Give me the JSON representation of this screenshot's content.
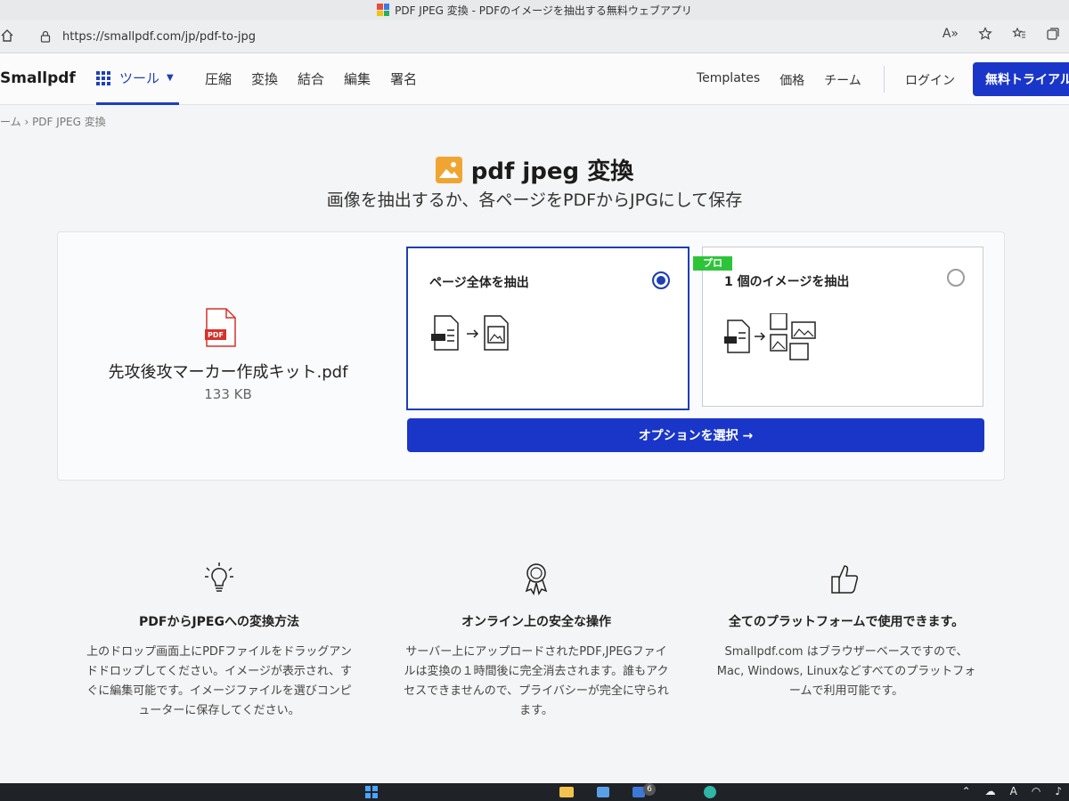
{
  "browser": {
    "window_title": "PDF JPEG 変換 - PDFのイメージを抽出する無料ウェブアプリ",
    "url": "https://smallpdf.com/jp/pdf-to-jpg",
    "reader_icon": "A»"
  },
  "nav": {
    "logo": "Smallpdf",
    "tools_label": "ツール",
    "links": [
      "圧縮",
      "変換",
      "結合",
      "編集",
      "署名"
    ],
    "templates": "Templates",
    "pricing": "価格",
    "team": "チーム",
    "login": "ログイン",
    "trial": "無料トライアル"
  },
  "breadcrumb": "ーム › PDF JPEG 変換",
  "page": {
    "title": "pdf jpeg 変換",
    "subtitle": "画像を抽出するか、各ページをPDFからJPGにして保存"
  },
  "file": {
    "name": "先攻後攻マーカー作成キット.pdf",
    "size": "133 KB",
    "badge": "PDF"
  },
  "options": [
    {
      "label": "ページ全体を抽出",
      "selected": true
    },
    {
      "label": "1 個のイメージを抽出",
      "selected": false,
      "badge": "プロ"
    }
  ],
  "select_button": "オプションを選択 →",
  "features": [
    {
      "title": "PDFからJPEGへの変換方法",
      "text": "上のドロップ画面上にPDFファイルをドラッグアンドドロップしてください。イメージが表示され、すぐに編集可能です。イメージファイルを選びコンピューターに保存してください。"
    },
    {
      "title": "オンライン上の安全な操作",
      "text": "サーバー上にアップロードされたPDF,JPEGファイルは変換の１時間後に完全消去されます。誰もアクセスできませんので、プライバシーが完全に守られます。"
    },
    {
      "title": "全てのプラットフォームで使用できます。",
      "text": "Smallpdf.com はブラウザーベースですので、Mac, Windows, Linuxなどすべてのプラットフォームで利用可能です。"
    }
  ],
  "taskbar": {
    "notification_count": "6",
    "ime": "A"
  },
  "colors": {
    "accent": "#1a36c9",
    "pro_badge": "#2ec43a",
    "pdf_red": "#d6322b",
    "image_icon": "#f0a533"
  }
}
